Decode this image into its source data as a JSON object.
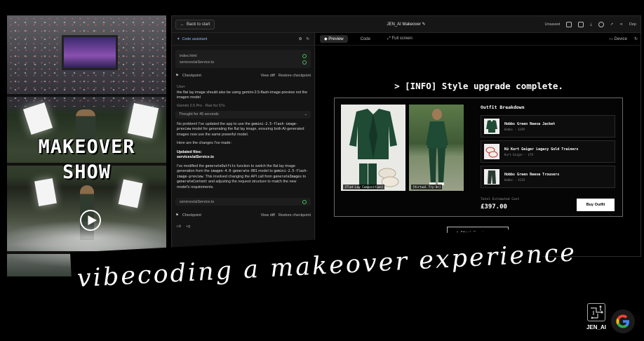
{
  "video": {
    "title_line1": "MAKEOVER",
    "title_line2": "SHOW"
  },
  "topbar": {
    "back_label": "Back to start",
    "app_title": "JEN_AI Makeover",
    "unsaved_label": "Unsaved",
    "deploy_label": "Dep"
  },
  "chat": {
    "create_label": "Code assistant",
    "files": [
      "index.html",
      "services/aiService.ts"
    ],
    "checkpoint_label": "Checkpoint",
    "view_diff": "View diff",
    "restore": "Restore checkpoint",
    "user_who": "User",
    "user_message": "the flat lay image should also be using gemini-2.5-flash-image-preview not the imagen model",
    "model_line": "Gemini 2.5 Pro · Ran for 57s",
    "thought": "Thought for 45 seconds",
    "ai_p1_a": "No problem! I've updated the app to use the ",
    "ai_p1_code": "gemini-2.5-flash-image-preview",
    "ai_p1_b": " model for generating the flat lay image, ensuring both AI-generated images now use the same powerful model.",
    "ai_p2": "Here are the changes I've made:",
    "ai_updated_heading": "Updated files:",
    "ai_updated_file": "services/aiService.ts",
    "ai_p3_a": "I've modified the ",
    "ai_p3_code1": "generateOutfits",
    "ai_p3_b": " function to switch the flat lay image generation from the ",
    "ai_p3_code2": "imagen-4.0-generate-001",
    "ai_p3_c": " model to ",
    "ai_p3_code3": "gemini-2.5-flash-image-preview",
    "ai_p3_d": ". This involved changing the API call from ",
    "ai_p3_code4": "generateImages",
    "ai_p3_e": " to ",
    "ai_p3_code5": "generateContent",
    "ai_p3_f": " and adjusting the request structure to match the new model's requirements.",
    "file_single": "services/aiService.ts"
  },
  "preview": {
    "tabs": [
      "Preview",
      "Code",
      "Full screen"
    ],
    "device_label": "Device",
    "info_line": "> [INFO] Style upgrade complete.",
    "flat_lay_label": "[Flat Lay Composition]",
    "try_on_label": "[Virtual Try-On]",
    "breakdown_title": "Outfit Breakdown",
    "items": [
      {
        "name": "Hobbs Green Reeva Jacket",
        "meta": "Hobbs - £199"
      },
      {
        "name": "Kú Kurt Geiger Legacy Gold Trainers",
        "meta": "Kurt Geiger - £79"
      },
      {
        "name": "Hobbs Green Reeva Trousers",
        "meta": "Hobbs - £119"
      }
    ],
    "total_label": "Total Estimated Cost",
    "total_value": "£397.00",
    "buy_label": "Buy Outfit",
    "start_label": "> Start New Makeover"
  },
  "tagline": "vibecoding a makeover experience",
  "brand": {
    "jen_label": "JEN_AI",
    "google_letter": "G"
  },
  "colors": {
    "accent_blue": "#8fb3ff",
    "check_green": "#3fbf5f",
    "outfit_green": "#1f4a34"
  }
}
